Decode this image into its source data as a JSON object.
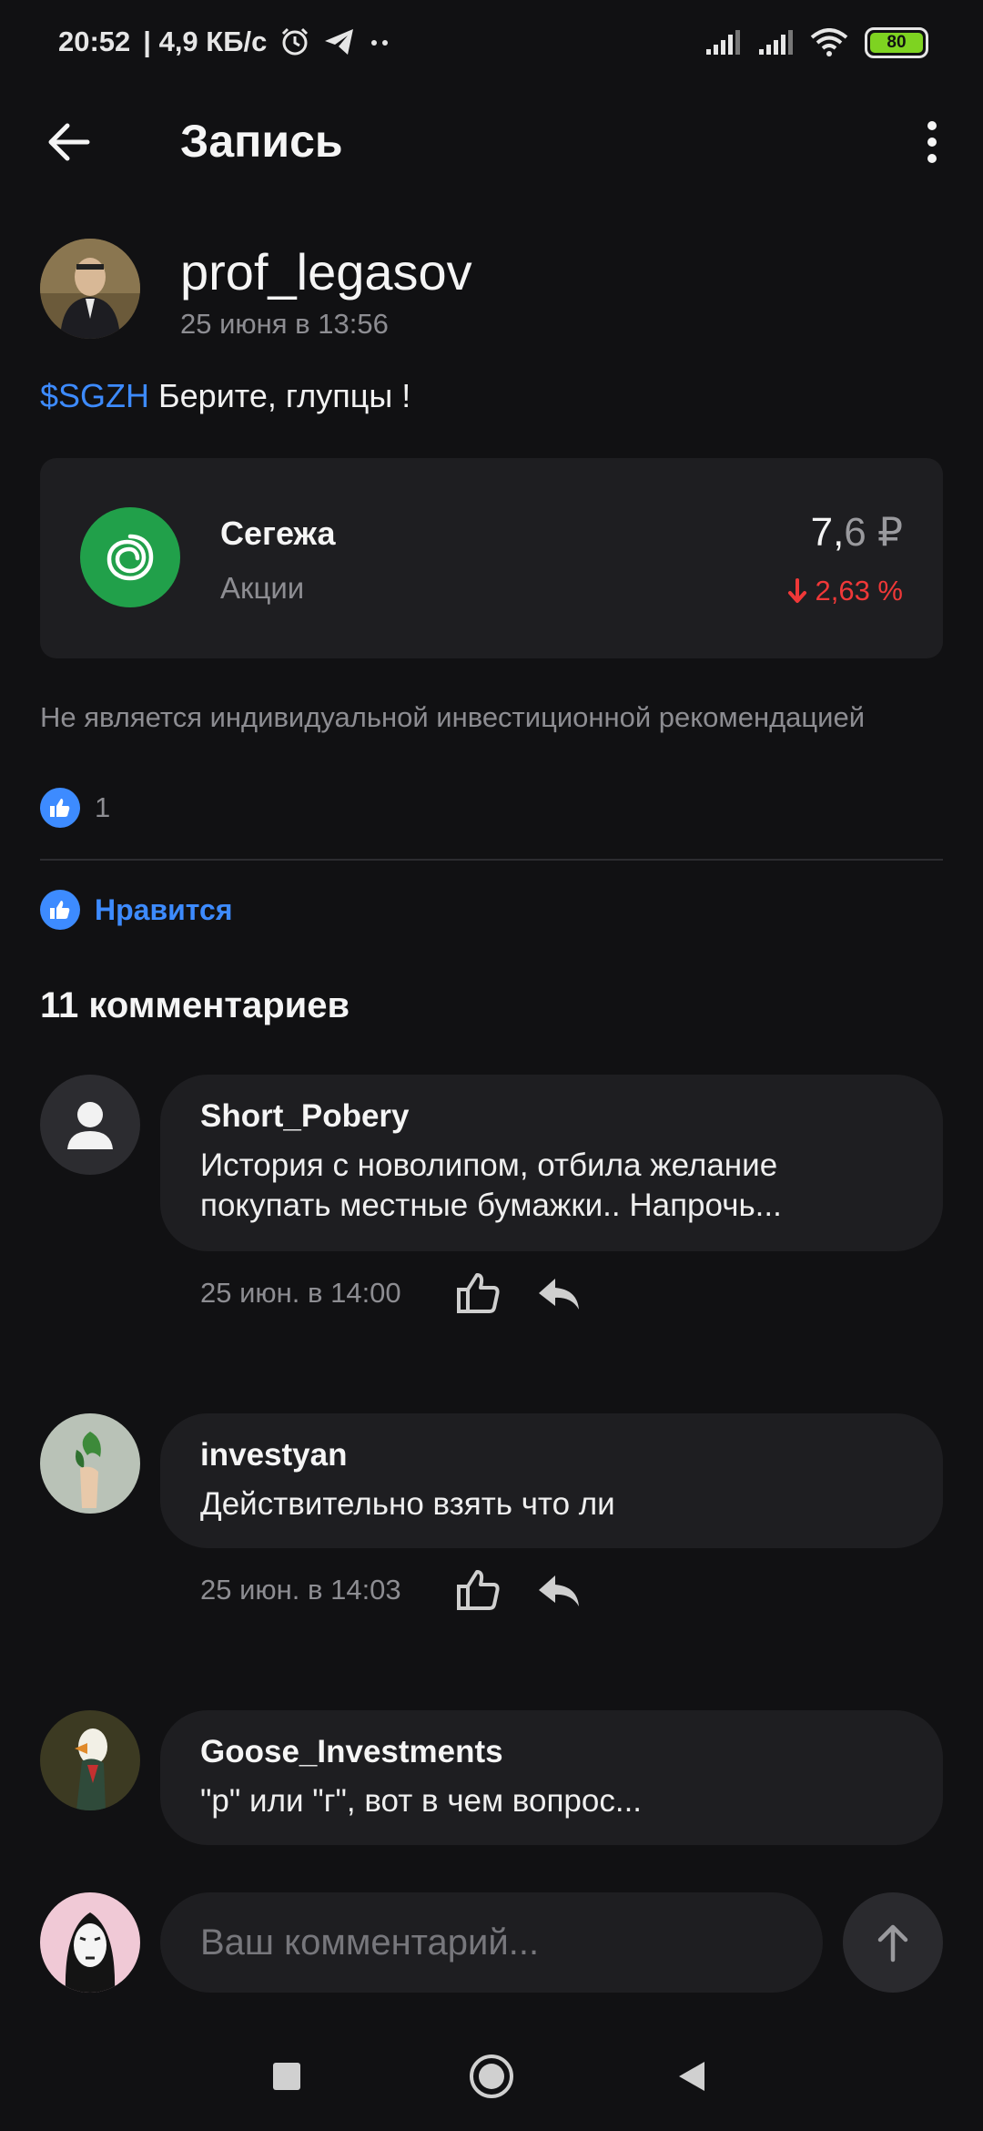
{
  "status_bar": {
    "time": "20:52",
    "network_speed": "| 4,9 КБ/с",
    "battery_level": "80",
    "icons": [
      "alarm-icon",
      "telegram-icon",
      "more-dots-icon",
      "signal-icon",
      "signal-icon",
      "wifi-icon",
      "battery-icon"
    ]
  },
  "app_bar": {
    "title": "Запись",
    "icons": [
      "back-arrow-icon",
      "more-vertical-icon"
    ]
  },
  "post": {
    "author": "prof_legasov",
    "date": "25 июня в 13:56",
    "ticker": "$SGZH",
    "text": " Берите, глупцы !",
    "stock": {
      "name": "Сегежа",
      "type": "Акции",
      "price_int": "7,",
      "price_dec": "6",
      "currency": " ₽",
      "change": "2,63 %",
      "change_direction": "down",
      "logo_color": "#21a04a"
    },
    "disclaimer": "Не является индивидуальной инвестиционной рекомендацией",
    "likes_count": "1",
    "like_label": "Нравится"
  },
  "comments_heading": "11 комментариев",
  "comments": [
    {
      "author": "Short_Pobery",
      "text_line1": "История с новолипом, отбила желание",
      "text_line2": "покупать местные бумажки.. Напрочь...",
      "time": "25 июн. в 14:00"
    },
    {
      "author": "investyan",
      "text_line1": "Действительно взять что ли",
      "text_line2": "",
      "time": "25 июн. в 14:03"
    },
    {
      "author": "Goose_Investments",
      "text_line1": "\"р\" или \"г\", вот в чем вопрос...",
      "text_line2": "",
      "time": ""
    }
  ],
  "comment_input": {
    "placeholder": "Ваш комментарий..."
  },
  "colors": {
    "background": "#111113",
    "card": "#1e1e21",
    "accent": "#3d8bff",
    "negative": "#f03838"
  }
}
